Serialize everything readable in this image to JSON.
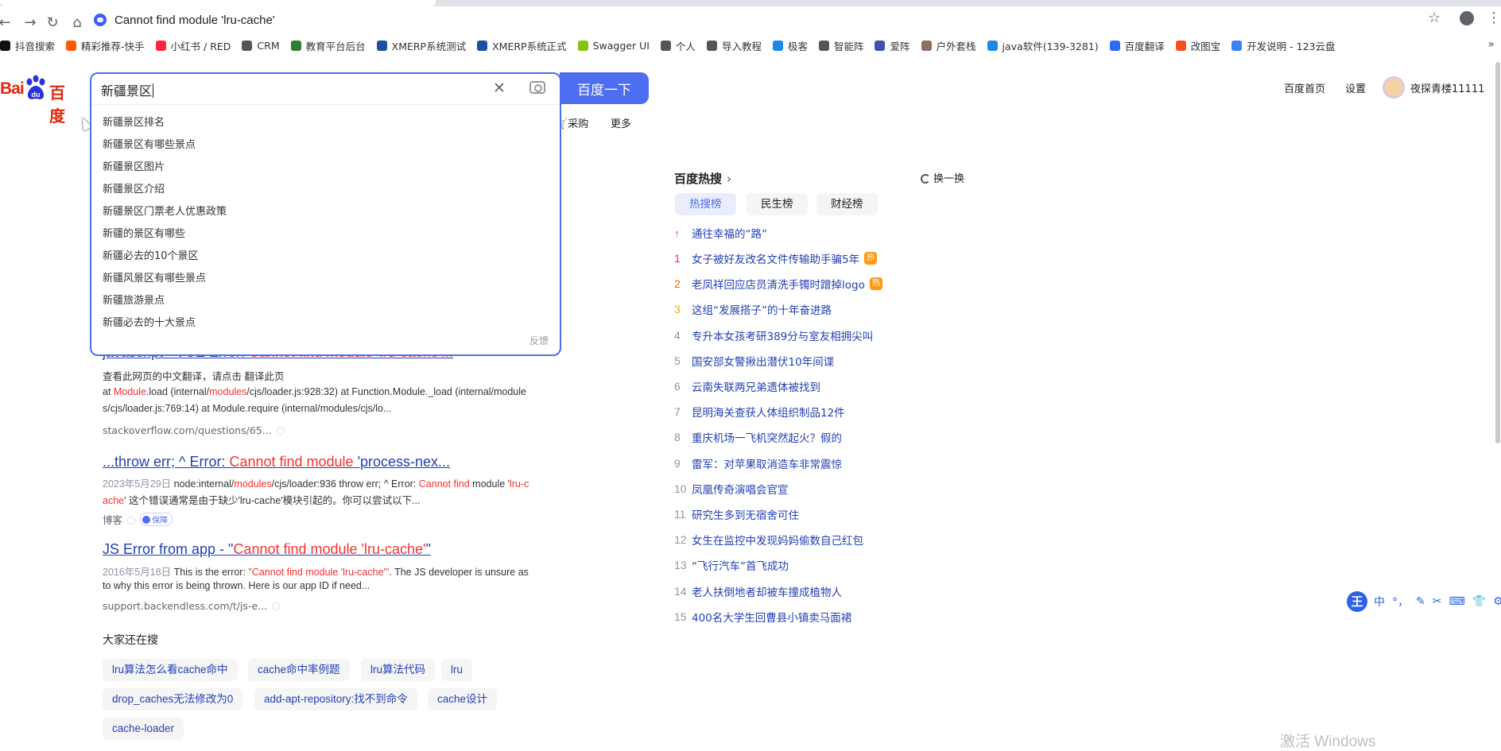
{
  "browser": {
    "url": "Cannot find module 'lru-cache'",
    "bookmarks": [
      {
        "label": "抖音搜索",
        "color": "#111111"
      },
      {
        "label": "精彩推荐-快手",
        "color": "#ff5a00"
      },
      {
        "label": "小红书 / RED",
        "color": "#ff2442"
      },
      {
        "label": "CRM",
        "color": "#555555"
      },
      {
        "label": "教育平台后台",
        "color": "#2e7d32"
      },
      {
        "label": "XMERP系统测试",
        "color": "#1a4fa3"
      },
      {
        "label": "XMERP系统正式",
        "color": "#1a4fa3"
      },
      {
        "label": "Swagger UI",
        "color": "#85c20b"
      },
      {
        "label": "个人",
        "color": "#555555"
      },
      {
        "label": "导入教程",
        "color": "#555555"
      },
      {
        "label": "极客",
        "color": "#1e88e5"
      },
      {
        "label": "智能阵",
        "color": "#555555"
      },
      {
        "label": "爱阵",
        "color": "#3f51b5"
      },
      {
        "label": "户外套栈",
        "color": "#8d6e63"
      },
      {
        "label": "java软件(139-3281)",
        "color": "#1e88e5"
      },
      {
        "label": "百度翻译",
        "color": "#2f6cf5"
      },
      {
        "label": "改图宝",
        "color": "#f4511e"
      },
      {
        "label": "开发说明 - 123云盘",
        "color": "#3b82f6"
      }
    ]
  },
  "header": {
    "logo_bai": "Bai",
    "logo_du": "百度",
    "search_value": "新疆景区",
    "search_button": "百度一下",
    "tabs_visible": [
      "采购",
      "更多"
    ],
    "home_link": "百度首页",
    "settings_link": "设置",
    "username": "夜探青楼11111"
  },
  "suggestions": {
    "items": [
      "新疆景区排名",
      "新疆景区有哪些景点",
      "新疆景区图片",
      "新疆景区介绍",
      "新疆景区门票老人优惠政策",
      "新疆的景区有哪些",
      "新疆必去的10个景区",
      "新疆风景区有哪些景点",
      "新疆旅游景点",
      "新疆必去的十大景点"
    ],
    "feedback": "反馈"
  },
  "results": [
    {
      "title_pre": "javascript - VUE Error: ",
      "title_red": "Cannot find module 'lru-cache'...",
      "title_post": "",
      "translate": "查看此网页的中文翻译，请点击 翻译此页",
      "line1_a": "at ",
      "line1_red1": "Module",
      "line1_b": ".load (internal/",
      "line1_red2": "modules",
      "line1_c": "/cjs/loader.js:928:32) at Function.Module._load (internal/module",
      "line2": "s/cjs/loader.js:769:14) at Module.require (internal/modules/cjs/lo...",
      "source": "stackoverflow.com/questions/65..."
    },
    {
      "title_pre": "...throw err; ^ Error: ",
      "title_red": "Cannot find module",
      "title_post": " 'process-nex...",
      "date": "2023年5月29日",
      "line1_a": " node:internal/",
      "line1_red1": "modules",
      "line1_b": "/cjs/loader:936 throw err; ^ Error: ",
      "line1_red2": "Cannot find",
      "line1_c": " module '",
      "line1_red3": "lru-c",
      "line2_red": "ache",
      "line2": "' 这个错误通常是由于缺少'lru-cache'模块引起的。你可以尝试以下...",
      "source": "博客",
      "badge": "保障"
    },
    {
      "title_pre": "JS Error from app - \"",
      "title_red": "Cannot find module 'lru-cache'",
      "title_post": "\"",
      "date": "2016年5月18日",
      "line1_a": " This is the error: ",
      "line1_red1": "\"Cannot find module 'lru-cache'\"",
      "line1_b": ". The JS developer is unsure as",
      "line2": "to why this error is being thrown. Here is our app ID if need...",
      "source": "support.backendless.com/t/js-e..."
    }
  ],
  "also_search": {
    "title": "大家还在搜",
    "chips": [
      "lru算法怎么看cache命中",
      "cache命中率例题",
      "lru算法代码",
      "lru",
      "drop_caches无法修改为0",
      "add-apt-repository:找不到命令",
      "cache设计",
      "cache-loader"
    ]
  },
  "hot": {
    "title": "百度热搜",
    "refresh": "换一换",
    "tabs": [
      "热搜榜",
      "民生榜",
      "财经榜"
    ],
    "pinned": "通往幸福的“路”",
    "hot_badge": "热",
    "items": [
      {
        "rank": "1",
        "text": "女子被好友改名文件传输助手骗5年",
        "hot": true
      },
      {
        "rank": "2",
        "text": "老凤祥回应店员清洗手镯时蹭掉logo",
        "hot": true
      },
      {
        "rank": "3",
        "text": "这组“发展搭子”的十年奋进路",
        "hot": false
      },
      {
        "rank": "4",
        "text": "专升本女孩考研389分与室友相拥尖叫",
        "hot": false
      },
      {
        "rank": "5",
        "text": "国安部女警揪出潜伏10年间谍",
        "hot": false
      },
      {
        "rank": "6",
        "text": "云南失联两兄弟遗体被找到",
        "hot": false
      },
      {
        "rank": "7",
        "text": "昆明海关查获人体组织制品12件",
        "hot": false
      },
      {
        "rank": "8",
        "text": "重庆机场一飞机突然起火？假的",
        "hot": false
      },
      {
        "rank": "9",
        "text": "雷军：对苹果取消造车非常震惊",
        "hot": false
      },
      {
        "rank": "10",
        "text": "凤凰传奇演唱会官宣",
        "hot": false
      },
      {
        "rank": "11",
        "text": "研究生多到无宿舍可住",
        "hot": false
      },
      {
        "rank": "12",
        "text": "女生在监控中发现妈妈偷数自己红包",
        "hot": false
      },
      {
        "rank": "13",
        "text": "“飞行汽车”首飞成功",
        "hot": false
      },
      {
        "rank": "14",
        "text": "老人扶倒地者却被车撞成植物人",
        "hot": false
      },
      {
        "rank": "15",
        "text": "400名大学生回曹县小镇卖马面裙",
        "hot": false
      }
    ]
  },
  "ime": {
    "logo": "王",
    "items": [
      "中",
      "°，",
      "✎",
      "✂",
      "⌨",
      "👕",
      "⚙"
    ]
  },
  "watermark": "激活 Windows"
}
